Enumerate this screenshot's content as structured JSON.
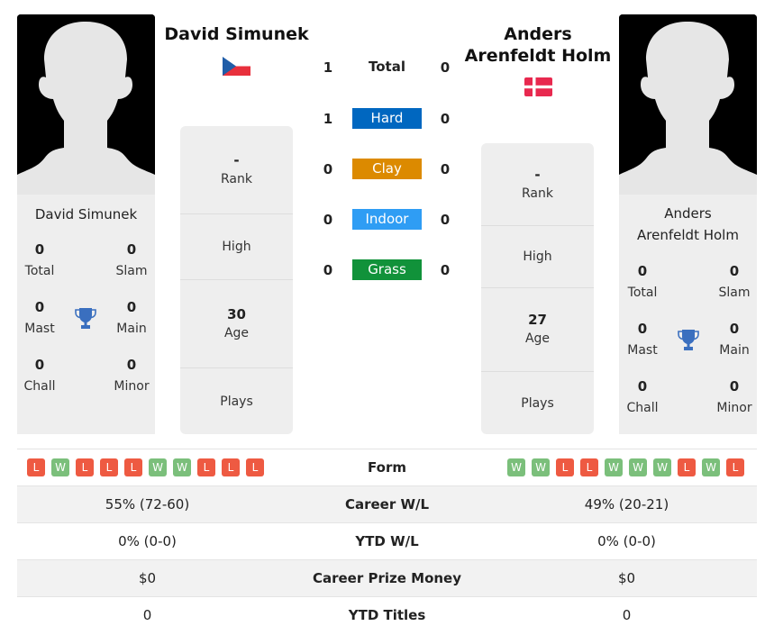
{
  "colors": {
    "hard": "#0067c0",
    "clay": "#dc8a00",
    "indoor": "#2f9df4",
    "grass": "#11923a",
    "win": "#7bbf7b",
    "loss": "#ee5a42",
    "trophy": "#3a6fbf",
    "card_bg": "#eeeeee"
  },
  "player1": {
    "name": "David Simunek",
    "flag": "czech-republic-flag",
    "card_name": "David Simunek",
    "titles": {
      "total": {
        "value": "0",
        "label": "Total"
      },
      "slam": {
        "value": "0",
        "label": "Slam"
      },
      "mast": {
        "value": "0",
        "label": "Mast"
      },
      "main": {
        "value": "0",
        "label": "Main"
      },
      "chall": {
        "value": "0",
        "label": "Chall"
      },
      "minor": {
        "value": "0",
        "label": "Minor"
      }
    },
    "rank": {
      "value": "-",
      "label": "Rank"
    },
    "high": {
      "value": "",
      "label": "High"
    },
    "age": {
      "value": "30",
      "label": "Age"
    },
    "plays": {
      "value": "",
      "label": "Plays"
    },
    "form": [
      "L",
      "W",
      "L",
      "L",
      "L",
      "W",
      "W",
      "L",
      "L",
      "L"
    ]
  },
  "player2": {
    "name": "Anders Arenfeldt Holm",
    "flag": "denmark-flag",
    "card_name_line1": "Anders",
    "card_name_line2": "Arenfeldt Holm",
    "titles": {
      "total": {
        "value": "0",
        "label": "Total"
      },
      "slam": {
        "value": "0",
        "label": "Slam"
      },
      "mast": {
        "value": "0",
        "label": "Mast"
      },
      "main": {
        "value": "0",
        "label": "Main"
      },
      "chall": {
        "value": "0",
        "label": "Chall"
      },
      "minor": {
        "value": "0",
        "label": "Minor"
      }
    },
    "rank": {
      "value": "-",
      "label": "Rank"
    },
    "high": {
      "value": "",
      "label": "High"
    },
    "age": {
      "value": "27",
      "label": "Age"
    },
    "plays": {
      "value": "",
      "label": "Plays"
    },
    "form": [
      "W",
      "W",
      "L",
      "L",
      "W",
      "W",
      "W",
      "L",
      "W",
      "L"
    ]
  },
  "h2h": [
    {
      "label": "Total",
      "left": "1",
      "right": "0",
      "surface": "total"
    },
    {
      "label": "Hard",
      "left": "1",
      "right": "0",
      "surface": "hard"
    },
    {
      "label": "Clay",
      "left": "0",
      "right": "0",
      "surface": "clay"
    },
    {
      "label": "Indoor",
      "left": "0",
      "right": "0",
      "surface": "indoor"
    },
    {
      "label": "Grass",
      "left": "0",
      "right": "0",
      "surface": "grass"
    }
  ],
  "comparison": {
    "form_label": "Form",
    "rows": [
      {
        "label": "Career W/L",
        "left": "55% (72-60)",
        "right": "49% (20-21)"
      },
      {
        "label": "YTD W/L",
        "left": "0% (0-0)",
        "right": "0% (0-0)"
      },
      {
        "label": "Career Prize Money",
        "left": "$0",
        "right": "$0"
      },
      {
        "label": "YTD Titles",
        "left": "0",
        "right": "0"
      }
    ]
  }
}
